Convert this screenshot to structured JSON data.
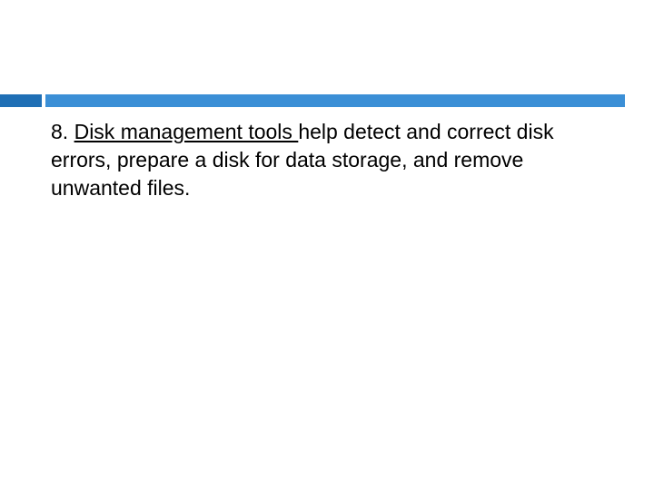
{
  "slide": {
    "number": "8. ",
    "term": "Disk management tools ",
    "description": "help detect and correct disk errors, prepare a disk for data storage, and remove unwanted files."
  }
}
